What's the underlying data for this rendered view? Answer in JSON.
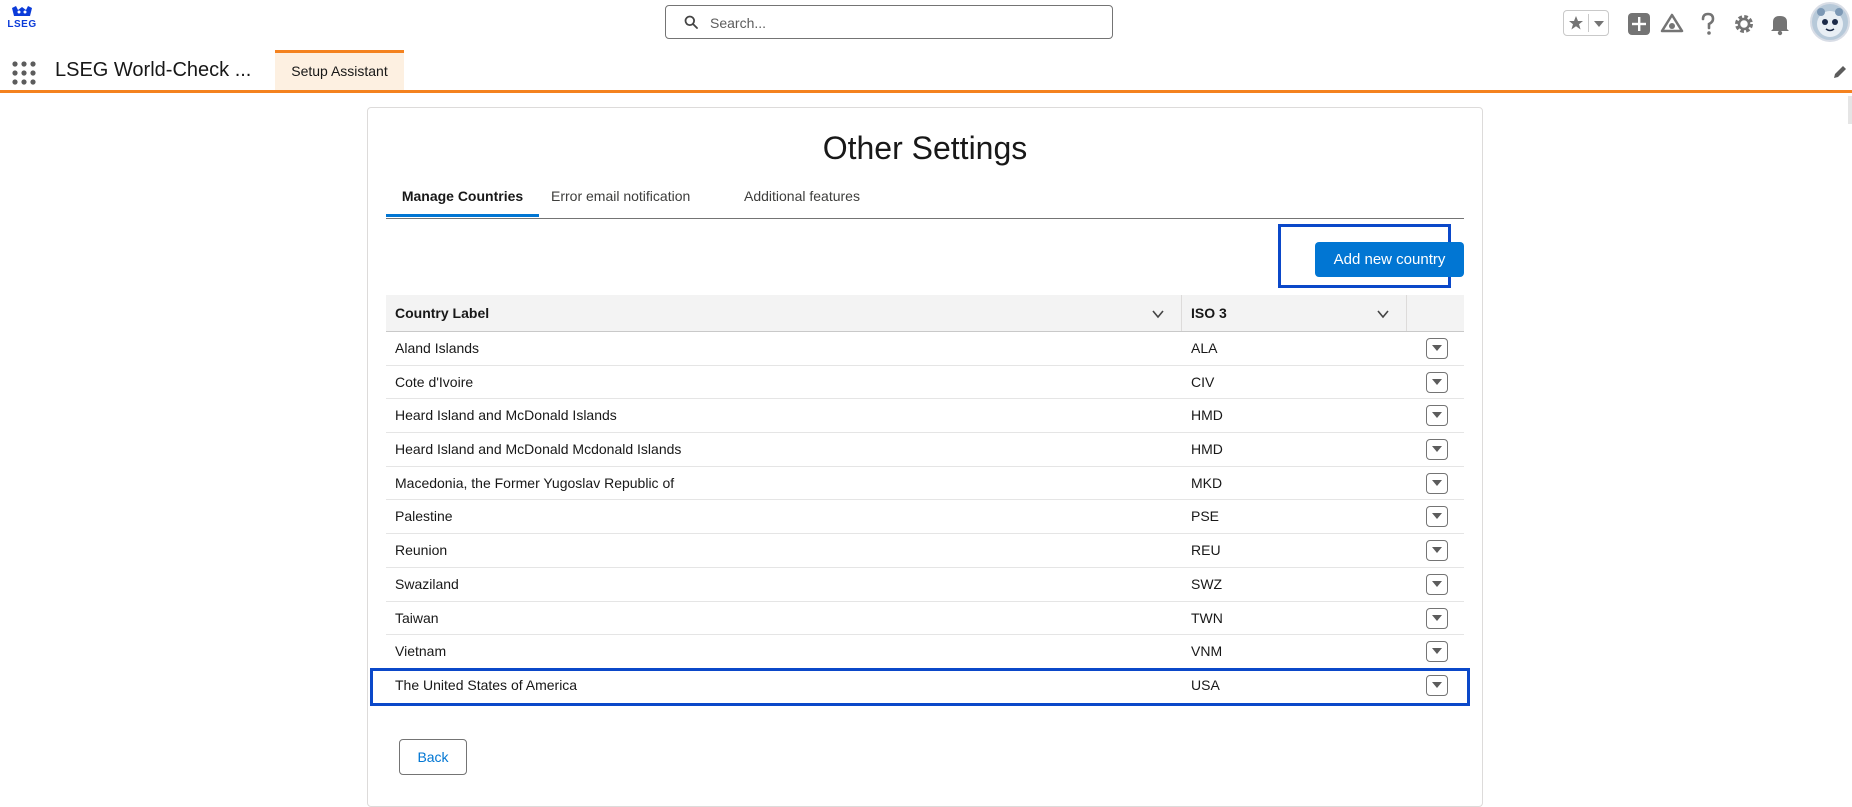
{
  "header": {
    "logo_text": "LSEG",
    "search_placeholder": "Search...",
    "icons": [
      "search-icon",
      "star-icon",
      "chevron-down-icon",
      "add-icon",
      "trailhead-icon",
      "help-icon",
      "gear-icon",
      "bell-icon",
      "avatar"
    ]
  },
  "nav": {
    "app_name": "LSEG World-Check ...",
    "tabs": [
      {
        "label": "Setup Assistant"
      }
    ]
  },
  "page": {
    "title": "Other Settings",
    "tabs": [
      {
        "label": "Manage Countries",
        "active": true
      },
      {
        "label": "Error email notification",
        "active": false
      },
      {
        "label": "Additional features",
        "active": false
      }
    ],
    "add_button": "Add new country",
    "back_button": "Back"
  },
  "table": {
    "columns": [
      "Country Label",
      "ISO 3"
    ],
    "rows": [
      {
        "label": "Aland Islands",
        "iso": "ALA"
      },
      {
        "label": "Cote d'Ivoire",
        "iso": "CIV"
      },
      {
        "label": "Heard Island and McDonald Islands",
        "iso": "HMD"
      },
      {
        "label": "Heard Island and McDonald Mcdonald Islands",
        "iso": "HMD"
      },
      {
        "label": "Macedonia, the Former Yugoslav Republic of",
        "iso": "MKD"
      },
      {
        "label": "Palestine",
        "iso": "PSE"
      },
      {
        "label": "Reunion",
        "iso": "REU"
      },
      {
        "label": "Swaziland",
        "iso": "SWZ"
      },
      {
        "label": "Taiwan",
        "iso": "TWN"
      },
      {
        "label": "Vietnam",
        "iso": "VNM"
      },
      {
        "label": "The United States of America",
        "iso": "USA"
      }
    ]
  },
  "colors": {
    "brand_blue": "#0176d3",
    "accent_orange": "#f4821f",
    "highlight_blue": "#0b48c9"
  }
}
